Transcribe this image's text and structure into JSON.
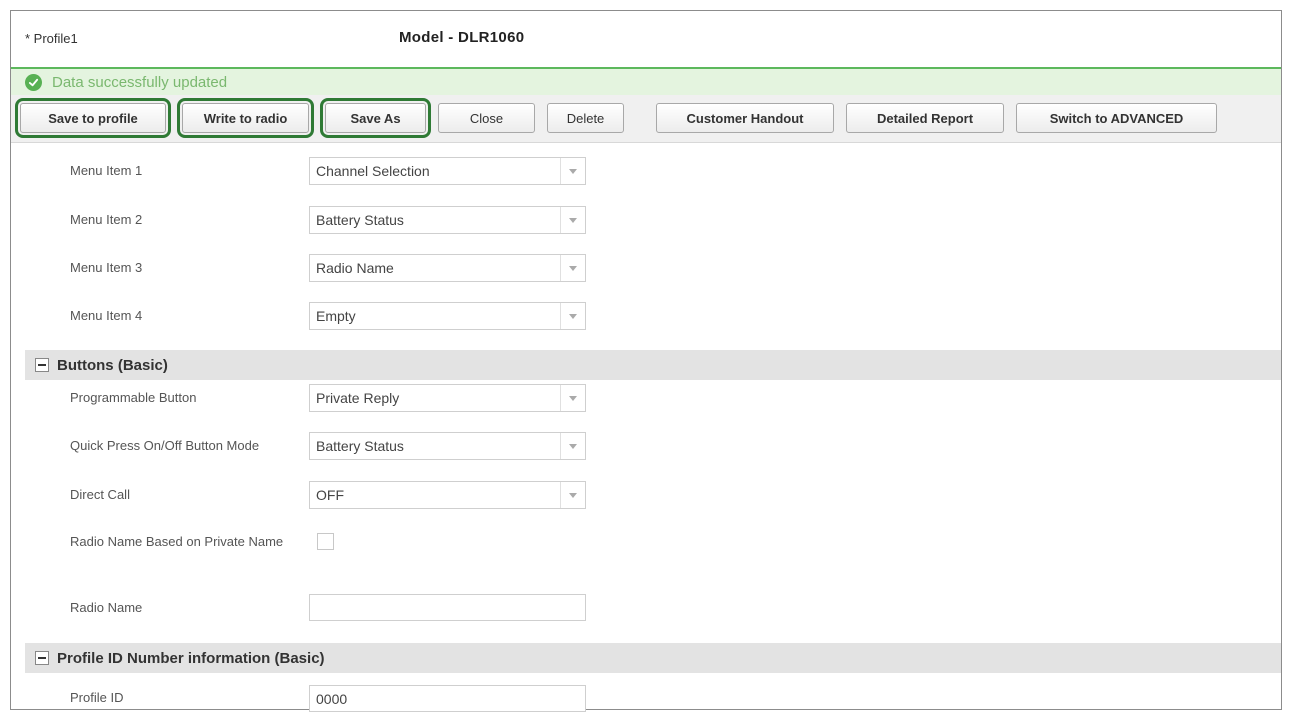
{
  "header": {
    "profile_name": "* Profile1",
    "model_title": "Model - DLR1060"
  },
  "status": {
    "message": "Data successfully updated",
    "icon": "check-circle-icon",
    "color": "#58b154"
  },
  "toolbar": {
    "save_to_profile": "Save to profile",
    "write_to_radio": "Write to radio",
    "save_as": "Save As",
    "close": "Close",
    "delete": "Delete",
    "customer_handout": "Customer Handout",
    "detailed_report": "Detailed Report",
    "switch_advanced": "Switch to ADVANCED"
  },
  "menu_items": [
    {
      "label": "Menu Item 1",
      "value": "Channel Selection"
    },
    {
      "label": "Menu Item 2",
      "value": "Battery Status"
    },
    {
      "label": "Menu Item 3",
      "value": "Radio Name"
    },
    {
      "label": "Menu Item 4",
      "value": "Empty"
    }
  ],
  "buttons_section": {
    "title": "Buttons (Basic)",
    "programmable_button": {
      "label": "Programmable Button",
      "value": "Private Reply"
    },
    "quick_press": {
      "label": "Quick Press On/Off Button Mode",
      "value": "Battery Status"
    },
    "direct_call": {
      "label": "Direct Call",
      "value": "OFF"
    },
    "radio_name_based": {
      "label": "Radio Name Based on Private Name",
      "checked": false
    },
    "radio_name": {
      "label": "Radio Name",
      "value": ""
    }
  },
  "profile_id_section": {
    "title": "Profile ID Number information (Basic)",
    "profile_id": {
      "label": "Profile ID",
      "value": "0000"
    }
  }
}
